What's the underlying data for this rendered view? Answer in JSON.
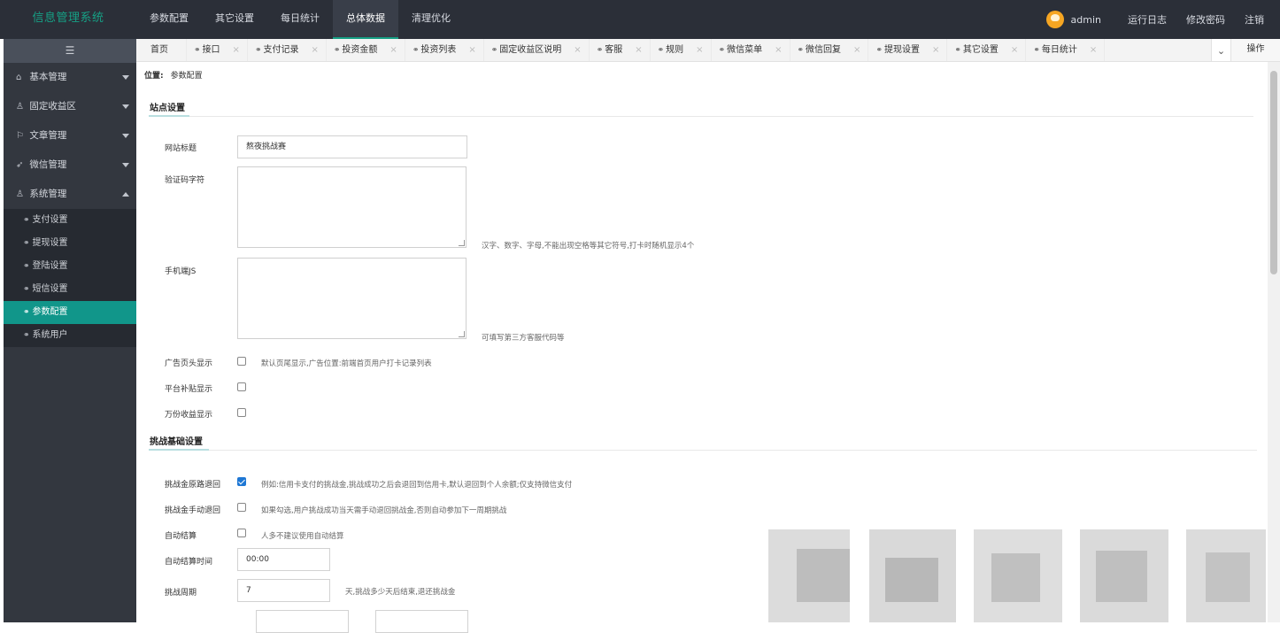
{
  "app": {
    "title": "信息管理系统"
  },
  "topnav": [
    {
      "label": "参数配置"
    },
    {
      "label": "其它设置"
    },
    {
      "label": "每日统计"
    },
    {
      "label": "总体数据",
      "active": true
    },
    {
      "label": "清理优化"
    }
  ],
  "user": {
    "name": "admin"
  },
  "topright": {
    "log": "运行日志",
    "password": "修改密码",
    "logout": "注销"
  },
  "sidebar": {
    "toggle_icon": "menu-icon",
    "groups": [
      {
        "label": "基本管理",
        "icon": "home-icon"
      },
      {
        "label": "固定收益区",
        "icon": "user-icon"
      },
      {
        "label": "文章管理",
        "icon": "flag-icon"
      },
      {
        "label": "微信管理",
        "icon": "send-icon"
      },
      {
        "label": "系统管理",
        "icon": "user-icon",
        "expanded": true
      }
    ],
    "subitems": [
      {
        "label": "支付设置"
      },
      {
        "label": "提现设置"
      },
      {
        "label": "登陆设置"
      },
      {
        "label": "短信设置"
      },
      {
        "label": "参数配置",
        "active": true
      },
      {
        "label": "系统用户"
      }
    ]
  },
  "tabs": [
    {
      "label": "首页"
    },
    {
      "label": "接口"
    },
    {
      "label": "支付记录"
    },
    {
      "label": "投资金额"
    },
    {
      "label": "投资列表"
    },
    {
      "label": "固定收益区说明"
    },
    {
      "label": "客服"
    },
    {
      "label": "规则"
    },
    {
      "label": "微信菜单"
    },
    {
      "label": "微信回复"
    },
    {
      "label": "提现设置"
    },
    {
      "label": "其它设置"
    },
    {
      "label": "每日统计"
    }
  ],
  "tab_ops": "操作",
  "breadcrumb": {
    "prefix": "位置:",
    "current": "参数配置"
  },
  "site_section": {
    "title": "站点设置",
    "site_title_label": "网站标题",
    "site_title_value": "熬夜挑战赛",
    "captcha_label": "验证码字符",
    "captcha_hint": "汉字、数字、字母,不能出现空格等其它符号,打卡时随机显示4个",
    "mobile_js_label": "手机端JS",
    "mobile_js_hint": "可填写第三方客服代码等",
    "ad_header_label": "广告页头显示",
    "ad_header_hint": "默认页尾显示,广告位置:前端首页用户打卡记录列表",
    "platform_subsidy_label": "平台补贴显示",
    "wanfen_label": "万份收益显示"
  },
  "challenge_section": {
    "title": "挑战基础设置",
    "refund_original_label": "挑战金原路退回",
    "refund_original_hint": "例如:信用卡支付的挑战金,挑战成功之后会退回到信用卡,默认退回到个人余额;仅支持微信支付",
    "refund_manual_label": "挑战金手动退回",
    "refund_manual_hint": "如果勾选,用户挑战成功当天需手动退回挑战金,否则自动参加下一周期挑战",
    "auto_settle_label": "自动结算",
    "auto_settle_hint": "人多不建议使用自动结算",
    "auto_settle_time_label": "自动结算时间",
    "auto_settle_time_value": "00:00",
    "cycle_label": "挑战周期",
    "cycle_value": "7",
    "cycle_hint": "天,挑战多少天后结束,退还挑战金"
  }
}
